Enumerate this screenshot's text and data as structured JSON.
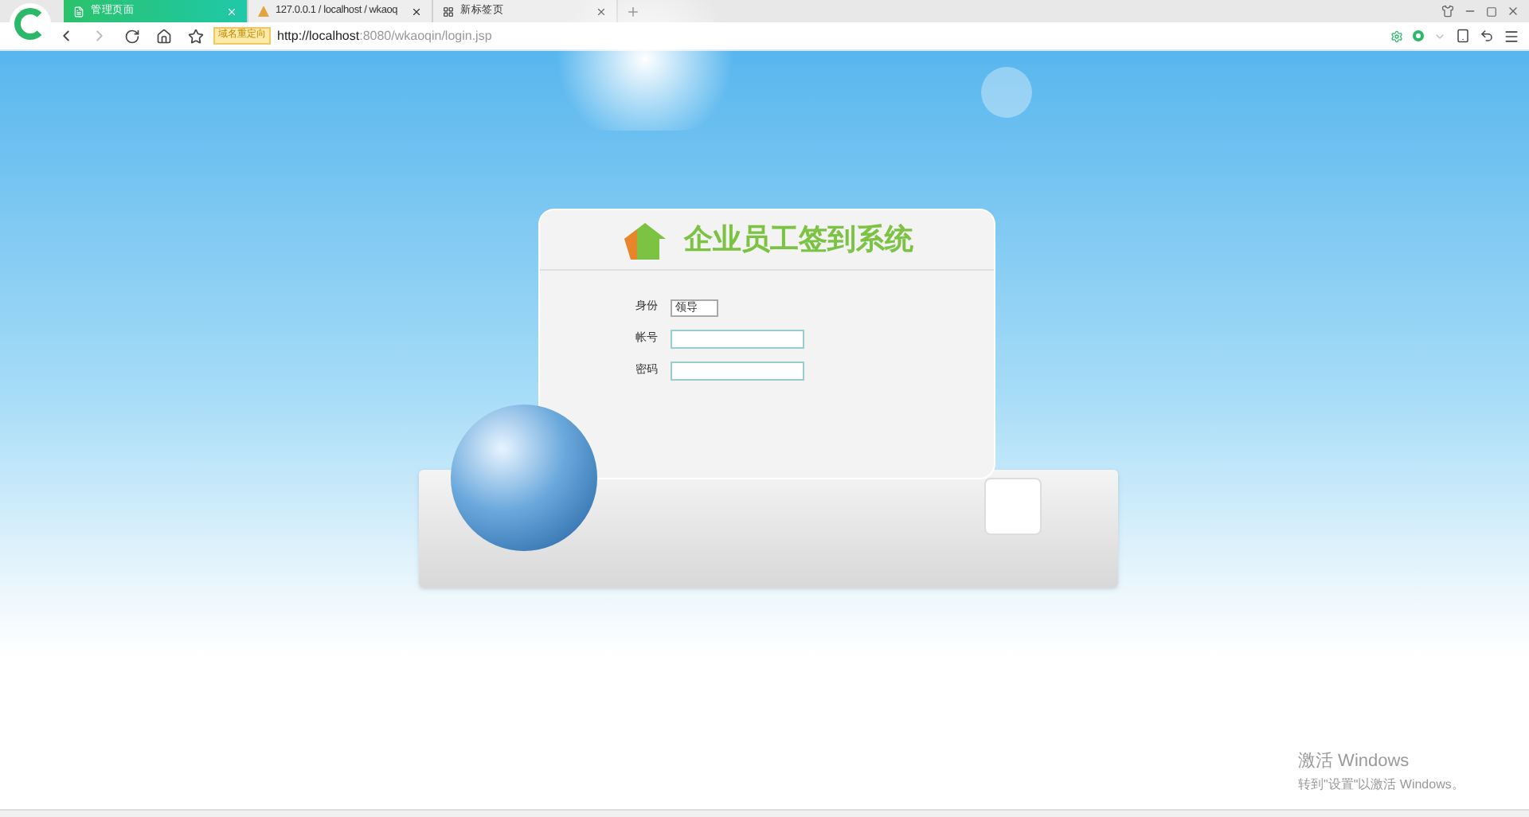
{
  "tabs": [
    {
      "label": "管理页面",
      "selected": true
    },
    {
      "label": "127.0.0.1 / localhost / wkaoq",
      "selected": false
    },
    {
      "label": "新标签页",
      "selected": false
    }
  ],
  "address_bar": {
    "badge": "域名重定向",
    "url_host": "http://localhost",
    "url_rest": ":8080/wkaoqin/login.jsp"
  },
  "login": {
    "title": "企业员工签到系统",
    "fields": [
      {
        "kind": "select",
        "label": "身份",
        "value": "领导"
      },
      {
        "kind": "text",
        "label": "帐号"
      },
      {
        "kind": "password",
        "label": "密码"
      }
    ]
  },
  "activation": {
    "title": "激活 Windows",
    "subtitle": "转到\"设置\"以激活 Windows。"
  }
}
